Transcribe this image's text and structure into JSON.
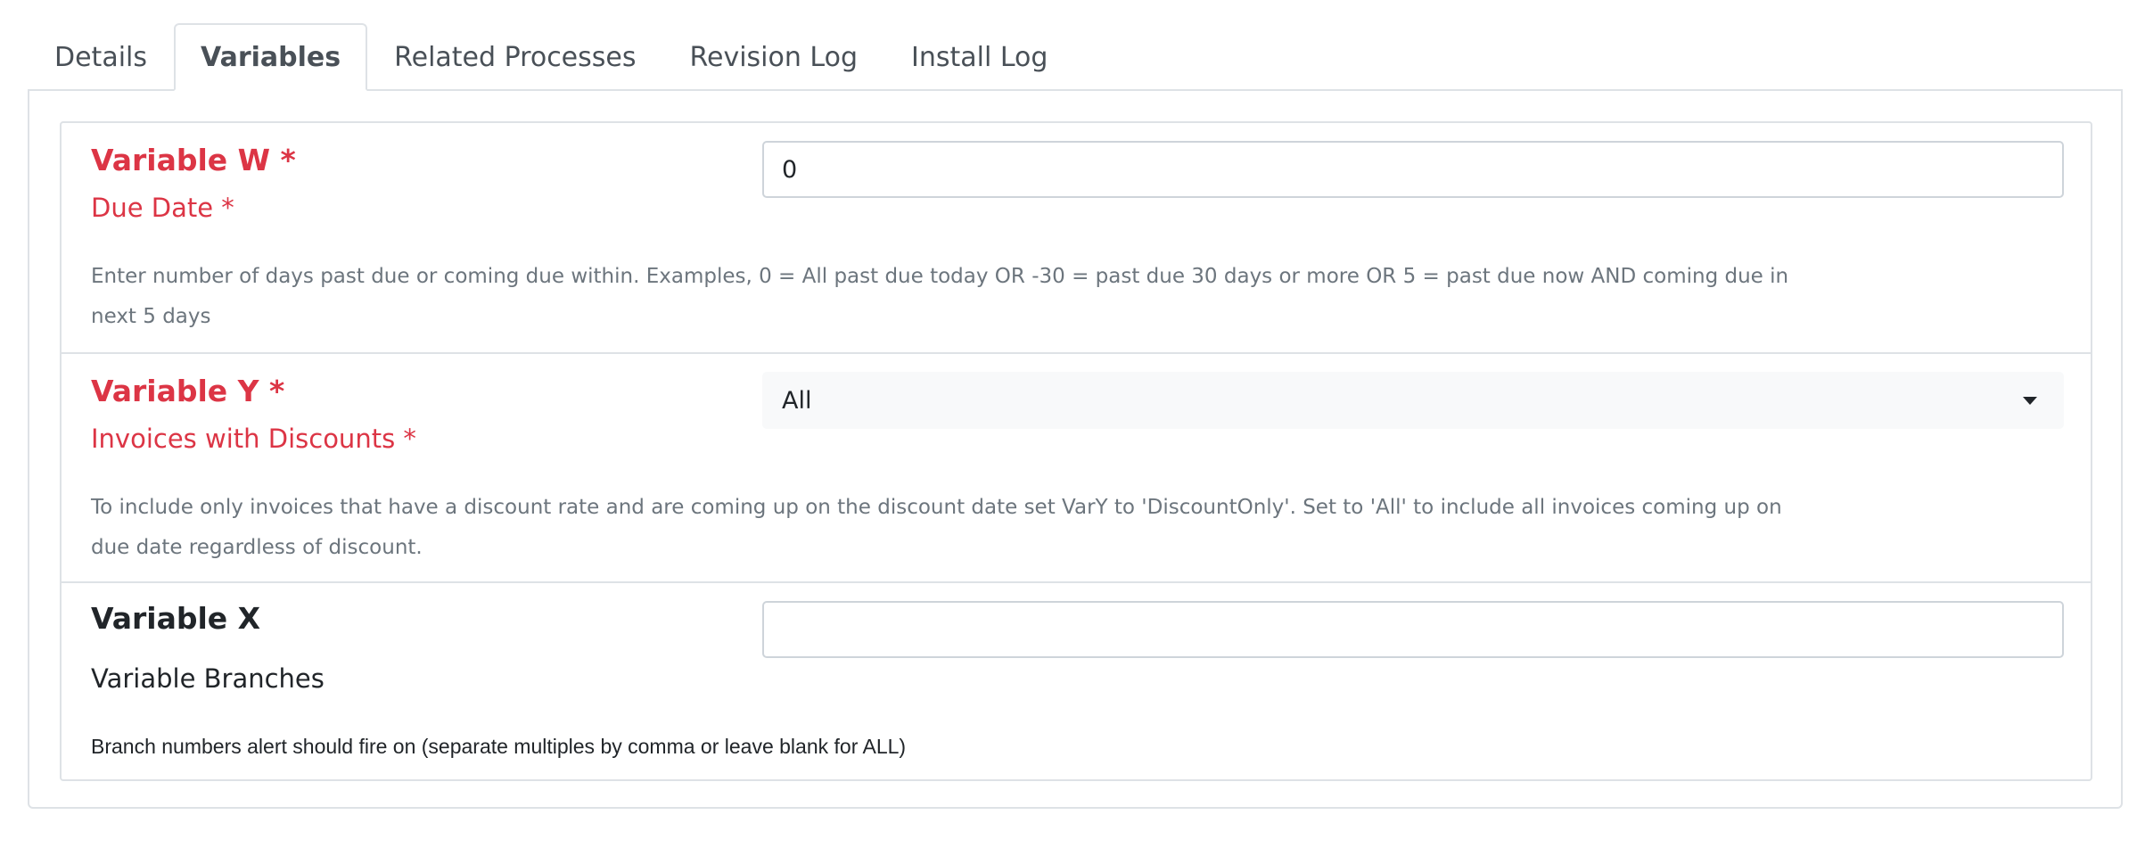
{
  "tabs": [
    {
      "label": "Details",
      "active": false
    },
    {
      "label": "Variables",
      "active": true
    },
    {
      "label": "Related Processes",
      "active": false
    },
    {
      "label": "Revision Log",
      "active": false
    },
    {
      "label": "Install Log",
      "active": false
    }
  ],
  "variables": {
    "w": {
      "name": "Variable W *",
      "label": "Due Date *",
      "value": "0",
      "help": "Enter number of days past due or coming due within. Examples, 0 = All past due today OR -30 = past due 30 days or more OR 5  = past due now AND coming due in next 5 days",
      "required": true
    },
    "y": {
      "name": "Variable Y *",
      "label": "Invoices with Discounts *",
      "selected": "All",
      "help": "To include only invoices that have a discount rate and are coming up on the discount date set VarY to 'DiscountOnly'. Set to 'All' to include all invoices coming up on due date regardless of discount.",
      "required": true
    },
    "x": {
      "name": "Variable X",
      "label": "Variable Branches",
      "value": "",
      "help": "Branch numbers alert should fire on (separate multiples by comma or leave blank for ALL)",
      "required": false
    }
  },
  "colors": {
    "required": "#dc3545",
    "help_text": "#6c757d",
    "border": "#dee2e6"
  },
  "icons": {
    "select_caret": "caret-down-icon"
  }
}
